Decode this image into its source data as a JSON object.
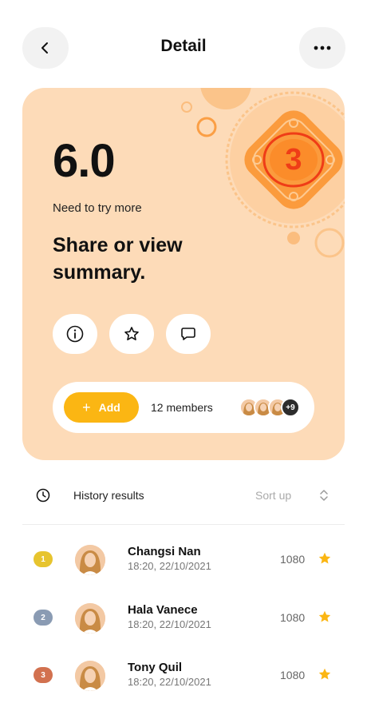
{
  "header": {
    "title": "Detail",
    "back_icon": "chevron-left-icon",
    "more_icon": "more-horizontal-icon"
  },
  "card": {
    "score": "6.0",
    "subtitle": "Need to try more",
    "headline": "Share or view summary.",
    "badge_number": "3",
    "background": "#fddbb8",
    "actions": [
      {
        "icon": "info-icon"
      },
      {
        "icon": "star-outline-icon"
      },
      {
        "icon": "comment-icon"
      }
    ],
    "members": {
      "add_label": "Add",
      "count_text": "12 members",
      "extra_count": "+9"
    }
  },
  "history": {
    "label": "History results",
    "sort_label": "Sort up",
    "rows": [
      {
        "rank": "1",
        "rank_color": "#e7c42e",
        "name": "Changsi Nan",
        "time": "18:20, 22/10/2021",
        "score": "1080"
      },
      {
        "rank": "2",
        "rank_color": "#8a9bb3",
        "name": "Hala Vanece",
        "time": "18:20, 22/10/2021",
        "score": "1080"
      },
      {
        "rank": "3",
        "rank_color": "#d2714f",
        "name": "Tony Quil",
        "time": "18:20, 22/10/2021",
        "score": "1080"
      }
    ]
  },
  "colors": {
    "accent": "#fbb613",
    "badge_orange": "#fb8c2a",
    "badge_red": "#ef3d17"
  }
}
